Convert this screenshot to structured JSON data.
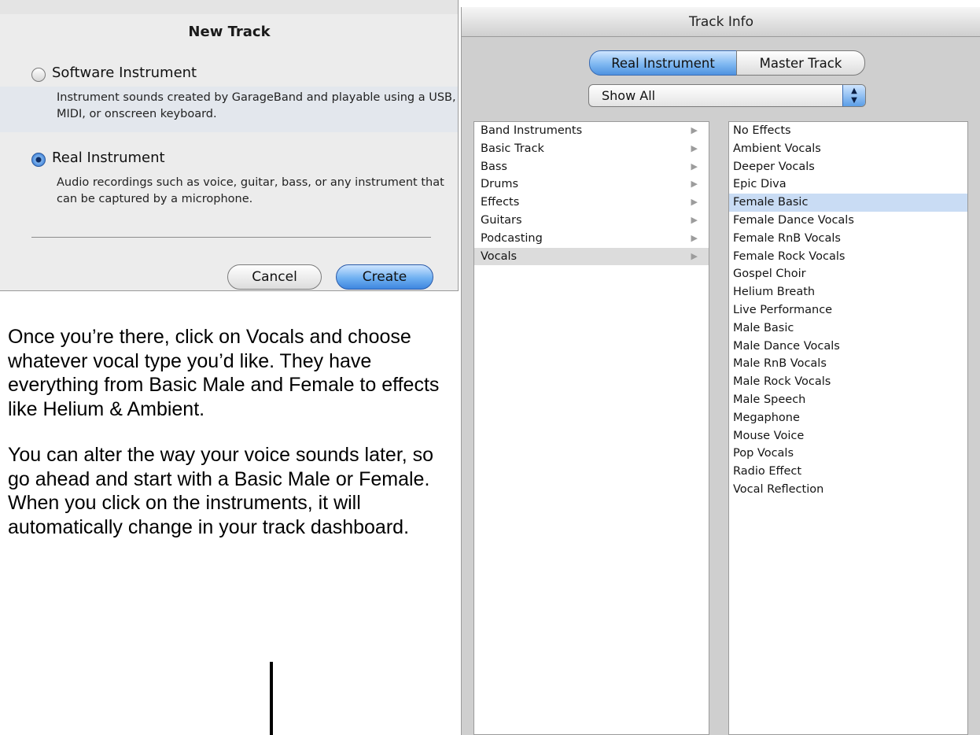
{
  "new_track": {
    "title": "New Track",
    "software": {
      "label": "Software Instrument",
      "description": "Instrument sounds created by GarageBand and playable using a USB, MIDI, or onscreen keyboard.",
      "selected": false
    },
    "real": {
      "label": "Real Instrument",
      "description": "Audio recordings such as voice, guitar, bass, or any instrument that can be captured by a microphone.",
      "selected": true
    },
    "cancel_label": "Cancel",
    "create_label": "Create"
  },
  "instructions": {
    "para1": "Once you’re there, click on Vocals and choose whatever vocal type you’d like. They have everything from Basic Male and Female to effects like Helium & Ambient.",
    "para2": "You can alter the way your voice sounds later, so go ahead and start with a Basic Male or Female.  When you click on the instruments, it will automatically change in your track dashboard."
  },
  "track_info": {
    "title": "Track Info",
    "tabs": [
      {
        "label": "Real Instrument",
        "active": true
      },
      {
        "label": "Master Track",
        "active": false
      }
    ],
    "filter": {
      "value": "Show All"
    },
    "categories": [
      {
        "label": "Band Instruments"
      },
      {
        "label": "Basic Track"
      },
      {
        "label": "Bass"
      },
      {
        "label": "Drums"
      },
      {
        "label": "Effects"
      },
      {
        "label": "Guitars"
      },
      {
        "label": "Podcasting"
      },
      {
        "label": "Vocals",
        "selected": true
      }
    ],
    "presets": [
      {
        "label": "No Effects"
      },
      {
        "label": "Ambient Vocals"
      },
      {
        "label": "Deeper Vocals"
      },
      {
        "label": "Epic Diva"
      },
      {
        "label": "Female Basic",
        "selected": true
      },
      {
        "label": "Female Dance Vocals"
      },
      {
        "label": "Female RnB Vocals"
      },
      {
        "label": "Female Rock Vocals"
      },
      {
        "label": "Gospel Choir"
      },
      {
        "label": "Helium Breath"
      },
      {
        "label": "Live Performance"
      },
      {
        "label": "Male Basic"
      },
      {
        "label": "Male Dance Vocals"
      },
      {
        "label": "Male RnB Vocals"
      },
      {
        "label": "Male Rock Vocals"
      },
      {
        "label": "Male Speech"
      },
      {
        "label": "Megaphone"
      },
      {
        "label": "Mouse Voice"
      },
      {
        "label": "Pop Vocals"
      },
      {
        "label": "Radio Effect"
      },
      {
        "label": "Vocal Reflection"
      }
    ],
    "arrow_glyph": "▶"
  }
}
